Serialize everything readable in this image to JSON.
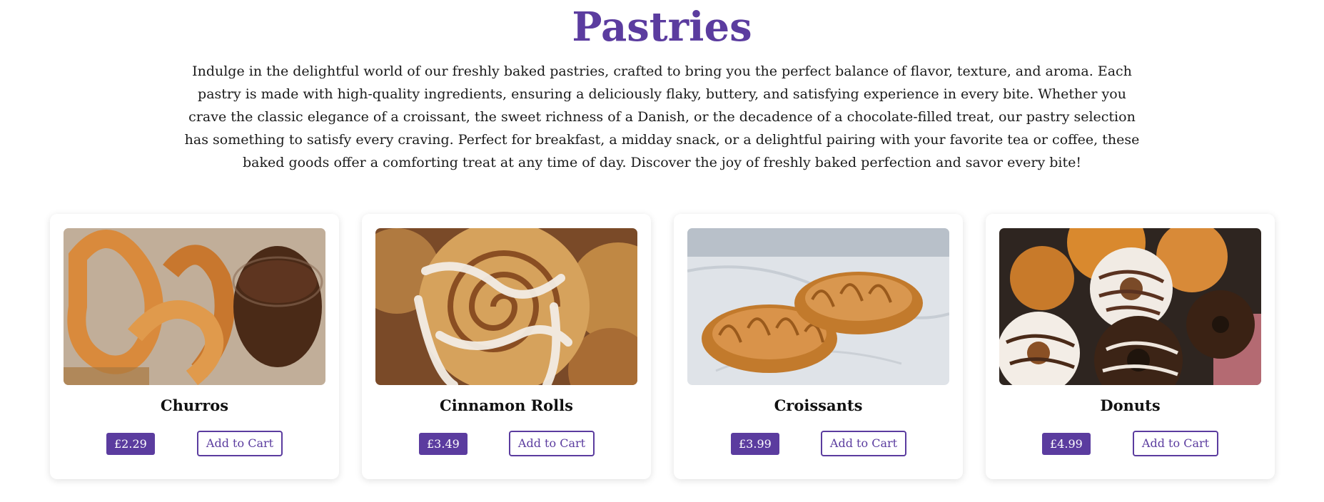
{
  "page": {
    "title": "Pastries",
    "intro": "Indulge in the delightful world of our freshly baked pastries, crafted to bring you the perfect balance of flavor, texture, and aroma. Each pastry is made with high-quality ingredients, ensuring a deliciously flaky, buttery, and satisfying experience in every bite. Whether you crave the classic elegance of a croissant, the sweet richness of a Danish, or the decadence of a chocolate-filled treat, our pastry selection has something to satisfy every craving. Perfect for breakfast, a midday snack, or a delightful pairing with your favorite tea or coffee, these baked goods offer a comforting treat at any time of day. Discover the joy of freshly baked perfection and savor every bite!"
  },
  "products": [
    {
      "name": "Churros",
      "price": "£2.29",
      "cart_label": "Add to Cart",
      "image_icon": "churros-photo"
    },
    {
      "name": "Cinnamon Rolls",
      "price": "£3.49",
      "cart_label": "Add to Cart",
      "image_icon": "cinnamon-rolls-photo"
    },
    {
      "name": "Croissants",
      "price": "£3.99",
      "cart_label": "Add to Cart",
      "image_icon": "croissants-photo"
    },
    {
      "name": "Donuts",
      "price": "£4.99",
      "cart_label": "Add to Cart",
      "image_icon": "donuts-photo"
    }
  ],
  "colors": {
    "accent": "#5b3c9f",
    "background": "#ffffff",
    "text": "#1a1a1a"
  }
}
